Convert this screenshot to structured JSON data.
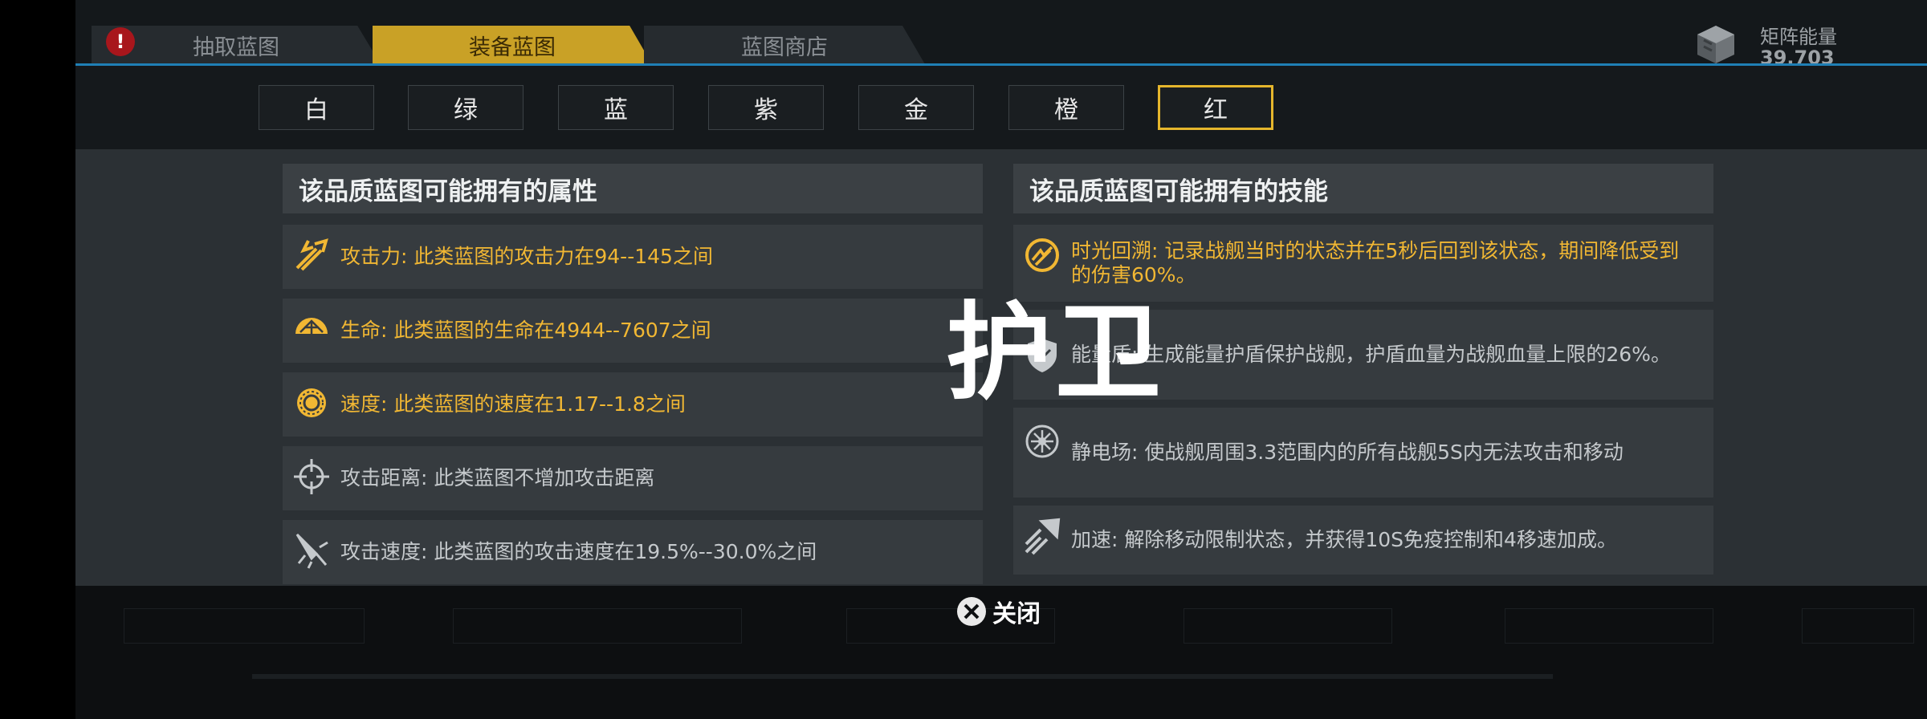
{
  "tabs": [
    {
      "label": "抽取蓝图",
      "active": false
    },
    {
      "label": "装备蓝图",
      "active": true
    },
    {
      "label": "蓝图商店",
      "active": false
    }
  ],
  "tab_alert": "!",
  "energy": {
    "label": "矩阵能量",
    "value": "39,703"
  },
  "rarities": [
    {
      "label": "白",
      "selected": false
    },
    {
      "label": "绿",
      "selected": false
    },
    {
      "label": "蓝",
      "selected": false
    },
    {
      "label": "紫",
      "selected": false
    },
    {
      "label": "金",
      "selected": false
    },
    {
      "label": "橙",
      "selected": false
    },
    {
      "label": "红",
      "selected": true
    }
  ],
  "attributes": {
    "title": "该品质蓝图可能拥有的属性",
    "items": [
      {
        "icon": "attack-power-icon",
        "text": "攻击力: 此类蓝图的攻击力在94--145之间",
        "highlight": true
      },
      {
        "icon": "hp-icon",
        "text": "生命: 此类蓝图的生命在4944--7607之间",
        "highlight": true
      },
      {
        "icon": "speed-icon",
        "text": "速度: 此类蓝图的速度在1.17--1.8之间",
        "highlight": true
      },
      {
        "icon": "crosshair-icon",
        "text": "攻击距离: 此类蓝图不增加攻击距离",
        "highlight": false
      },
      {
        "icon": "attack-speed-icon",
        "text": "攻击速度: 此类蓝图的攻击速度在19.5%--30.0%之间",
        "highlight": false
      }
    ]
  },
  "skills": {
    "title": "该品质蓝图可能拥有的技能",
    "items": [
      {
        "icon": "time-rewind-icon",
        "text": "时光回溯: 记录战舰当时的状态并在5秒后回到该状态，期间降低受到的伤害60%。",
        "highlight": true
      },
      {
        "icon": "energy-shield-icon",
        "text": "能量盾: 生成能量护盾保护战舰，护盾血量为战舰血量上限的26%。",
        "highlight": false
      },
      {
        "icon": "static-field-icon",
        "text": "静电场: 使战舰周围3.3范围内的所有战舰5S内无法攻击和移动",
        "highlight": false
      },
      {
        "icon": "accelerate-icon",
        "text": "加速: 解除移动限制状态，并获得10S免疫控制和4移速加成。",
        "highlight": false
      }
    ]
  },
  "overlay_title": "护卫",
  "close_label": "关闭",
  "colors": {
    "accent_gold": "#f1b733",
    "tab_active": "#c9a126",
    "topbar_line": "#1f7fb5",
    "selected_border": "#e5b62c"
  }
}
